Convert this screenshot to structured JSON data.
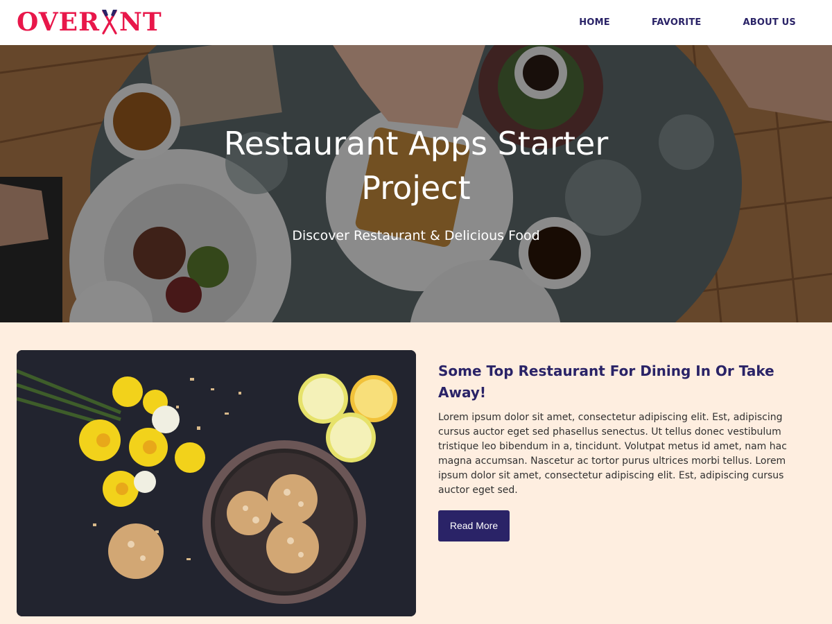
{
  "brand": {
    "logo_left": "OVER",
    "logo_right": "NT",
    "logo_icon": "fork-knife-icon",
    "color": "#e8174a"
  },
  "nav": {
    "items": [
      "HOME",
      "FAVORITE",
      "ABOUT US"
    ],
    "color": "#2a2367"
  },
  "hero": {
    "title": "Restaurant Apps Starter Project",
    "subtitle": "Discover Restaurant & Delicious Food"
  },
  "article": {
    "heading": "Some Top Restaurant For Dining In Or Take Away!",
    "body": "Lorem ipsum dolor sit amet, consectetur adipiscing elit. Est, adipiscing cursus auctor eget sed phasellus senectus. Ut tellus donec vestibulum tristique leo bibendum in a, tincidunt. Volutpat metus id amet, nam hac magna accumsan. Nascetur ac tortor purus ultrices morbi tellus. Lorem ipsum dolor sit amet, consectetur adipiscing elit. Est, adipiscing cursus auctor eget sed.",
    "button_label": "Read More"
  },
  "colors": {
    "accent": "#2a2367",
    "page_bg": "#feeee0",
    "brand_red": "#e8174a"
  }
}
